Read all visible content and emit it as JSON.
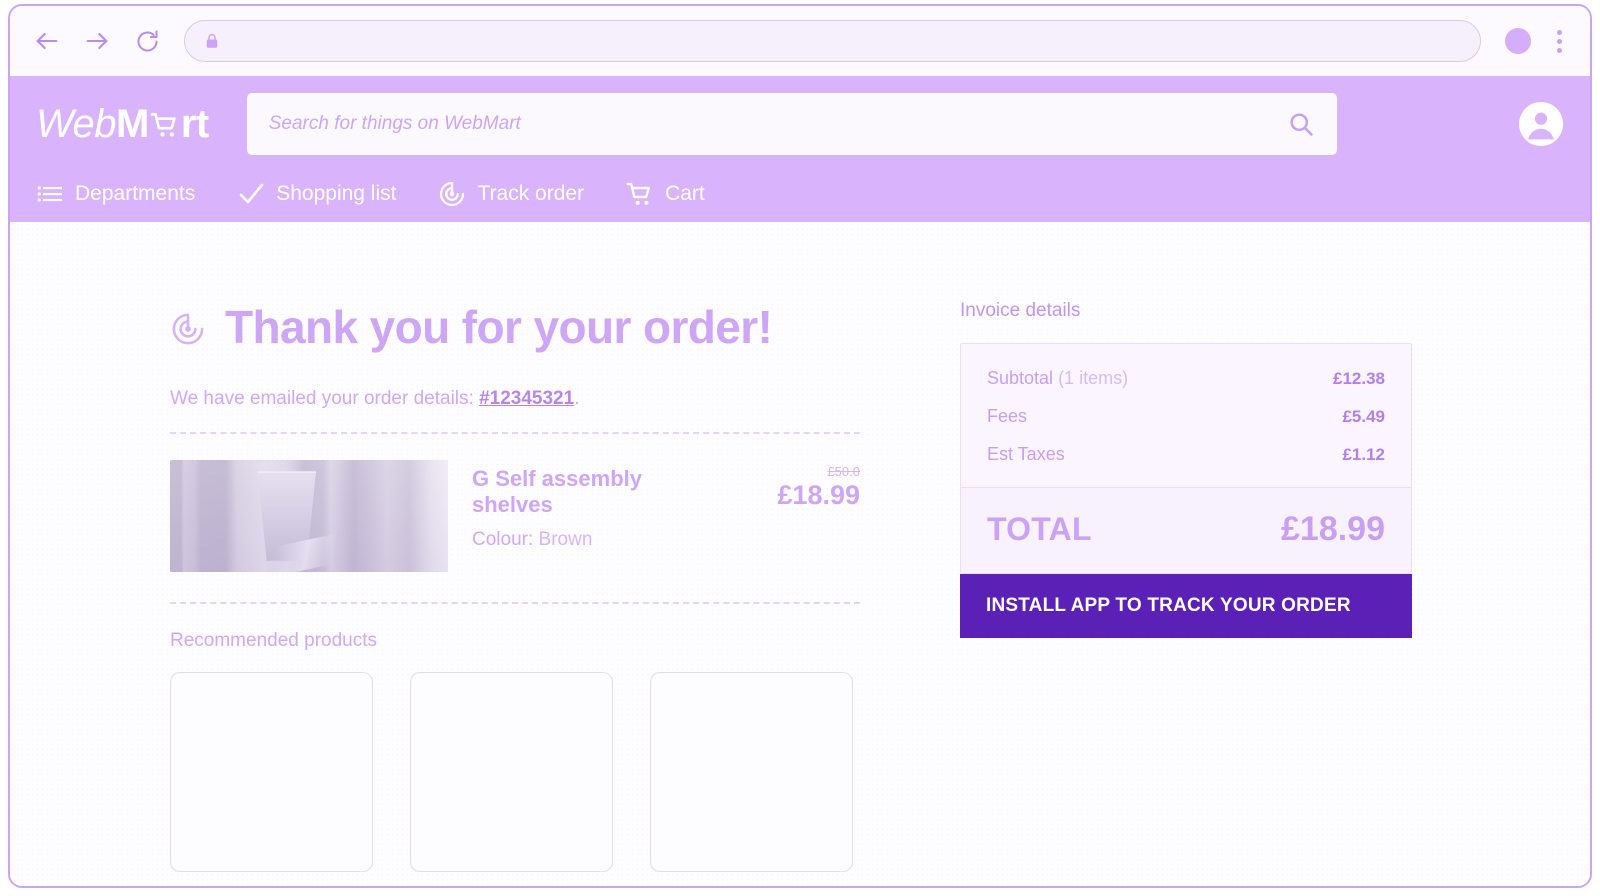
{
  "browser": {
    "back_icon": "arrow-left-icon",
    "forward_icon": "arrow-right-icon",
    "reload_icon": "reload-icon",
    "lock_icon": "lock-icon",
    "url": "",
    "profile_icon": "profile-avatar-icon",
    "menu_icon": "kebab-menu-icon"
  },
  "header": {
    "logo": {
      "part1": "Web",
      "part2": "M",
      "cart_icon": "shopping-cart-icon",
      "part3": "rt"
    },
    "search": {
      "value": "",
      "placeholder": "Search for things on WebMart",
      "icon": "search-icon"
    },
    "account_icon": "account-circle-icon",
    "nav": [
      {
        "label": "Departments",
        "icon": "menu-list-icon"
      },
      {
        "label": "Shopping list",
        "icon": "check-icon"
      },
      {
        "label": "Track order",
        "icon": "radar-target-icon"
      },
      {
        "label": "Cart",
        "icon": "shopping-cart-icon"
      }
    ]
  },
  "main": {
    "heading": {
      "icon": "radar-target-icon",
      "text": "Thank you for your order!"
    },
    "emailed": {
      "prefix": "We have emailed your order details: ",
      "order_number": "#12345321",
      "suffix": "."
    },
    "product": {
      "image_alt": "self-assembly-shelves-photo",
      "title": "G Self assembly shelves",
      "colour_label": "Colour:",
      "colour_value": "Brown",
      "price_old": "£50.0",
      "price_new": "£18.99"
    },
    "recommended": {
      "title": "Recommended products",
      "cards": [
        "",
        "",
        ""
      ]
    }
  },
  "invoice": {
    "label": "Invoice details",
    "lines": [
      {
        "label": "Subtotal",
        "sub": " (1 items)",
        "value": "£12.38"
      },
      {
        "label": "Fees",
        "sub": "",
        "value": "£5.49"
      },
      {
        "label": "Est Taxes",
        "sub": "",
        "value": "£1.12"
      }
    ],
    "total_label": "TOTAL",
    "total_value": "£18.99",
    "install_button": "INSTALL APP TO TRACK YOUR ORDER"
  },
  "colors": {
    "header_bg": "#d9b4fd",
    "brand_purple": "#cda6f6",
    "cta_purple": "#5b21b6",
    "panel_bg": "#faf5fe",
    "page_bg": "#fdfcfe"
  }
}
